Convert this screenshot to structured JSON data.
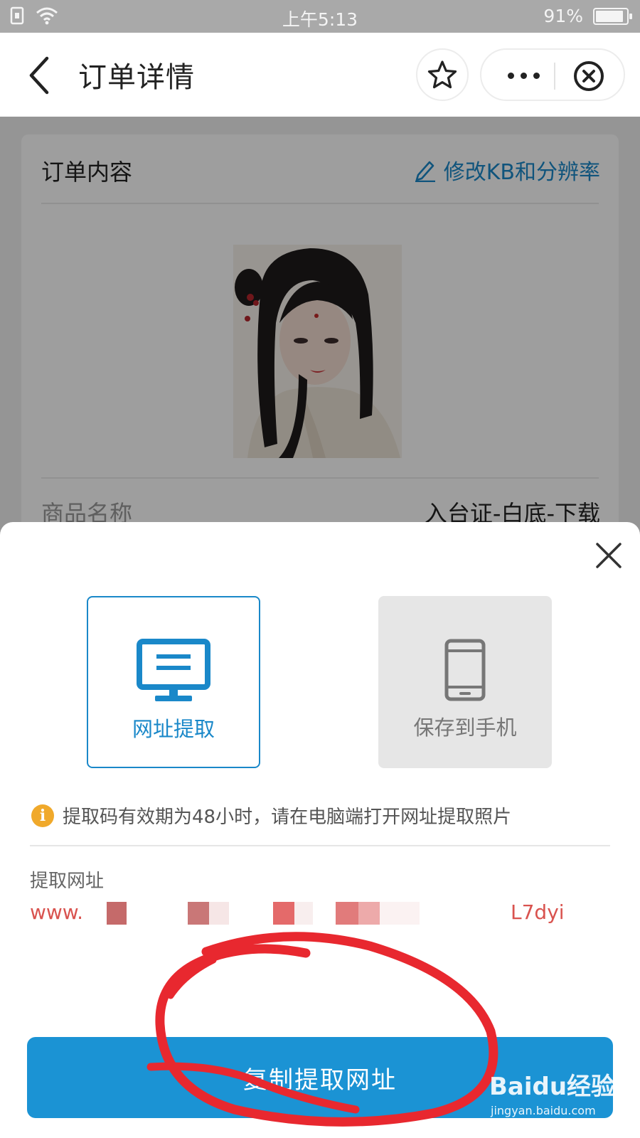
{
  "status_bar": {
    "time": "上午5:13",
    "battery": "91%",
    "battery_level": 0.91
  },
  "nav": {
    "title": "订单详情",
    "back_icon": "back-arrow-icon",
    "star_icon": "star-icon",
    "more_icon": "more-dots-icon",
    "close_icon": "close-circle-icon"
  },
  "order": {
    "section_title": "订单内容",
    "edit_link": "修改KB和分辨率",
    "photo_alt": "portrait",
    "product_label": "商品名称",
    "product_value": "入台证-白底-下载"
  },
  "sheet": {
    "options": [
      {
        "label": "网址提取",
        "icon": "monitor-icon",
        "selected": true
      },
      {
        "label": "保存到手机",
        "icon": "phone-icon",
        "selected": false
      }
    ],
    "tip": "提取码有效期为48小时，请在电脑端打开网址提取照片",
    "url_label": "提取网址",
    "url_start": "www.",
    "url_end": "L7dyi",
    "copy_button": "复制提取网址"
  },
  "watermark": {
    "brand": "Baidu经验",
    "domain": "jingyan.baidu.com"
  },
  "colors": {
    "accent": "#1a88c9",
    "button": "#1b93d4",
    "url": "#d9534f",
    "tip": "#f0a92b",
    "annotation": "#e8282f"
  }
}
